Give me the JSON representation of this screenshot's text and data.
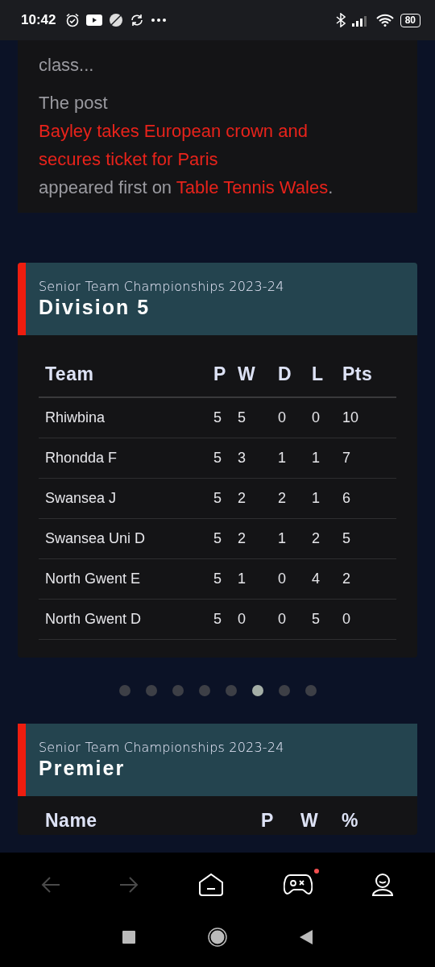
{
  "status_bar": {
    "time": "10:42",
    "battery": "80"
  },
  "article": {
    "excerpt_end": "class...",
    "post_prefix": "The post ",
    "post_link": "Bayley takes European crown and secures ticket for Paris",
    "post_middle": " appeared first on ",
    "site_link": "Table Tennis Wales",
    "post_suffix": "."
  },
  "league_table": {
    "subtitle": "Senior Team Championships 2023-24",
    "title": "Division 5",
    "columns": [
      "Team",
      "P",
      "W",
      "D",
      "L",
      "Pts"
    ],
    "rows": [
      [
        "Rhiwbina",
        "5",
        "5",
        "0",
        "0",
        "10"
      ],
      [
        "Rhondda F",
        "5",
        "3",
        "1",
        "1",
        "7"
      ],
      [
        "Swansea J",
        "5",
        "2",
        "2",
        "1",
        "6"
      ],
      [
        "Swansea Uni D",
        "5",
        "2",
        "1",
        "2",
        "5"
      ],
      [
        "North Gwent E",
        "5",
        "1",
        "0",
        "4",
        "2"
      ],
      [
        "North Gwent D",
        "5",
        "0",
        "0",
        "5",
        "0"
      ]
    ]
  },
  "carousel_dots": [
    {
      "selected": false
    },
    {
      "selected": false
    },
    {
      "selected": false
    },
    {
      "selected": false
    },
    {
      "selected": false
    },
    {
      "selected": true
    },
    {
      "selected": false
    },
    {
      "selected": false
    }
  ],
  "player_table": {
    "subtitle": "Senior Team Championships 2023-24",
    "title": "Premier",
    "columns": [
      "Name",
      "P",
      "W",
      "%"
    ]
  },
  "browser_nav": [
    {
      "kind": "back",
      "disabled": true
    },
    {
      "kind": "forward",
      "disabled": true
    },
    {
      "kind": "home",
      "disabled": false
    },
    {
      "kind": "games",
      "disabled": false,
      "notification": true
    },
    {
      "kind": "profile",
      "disabled": false
    }
  ]
}
